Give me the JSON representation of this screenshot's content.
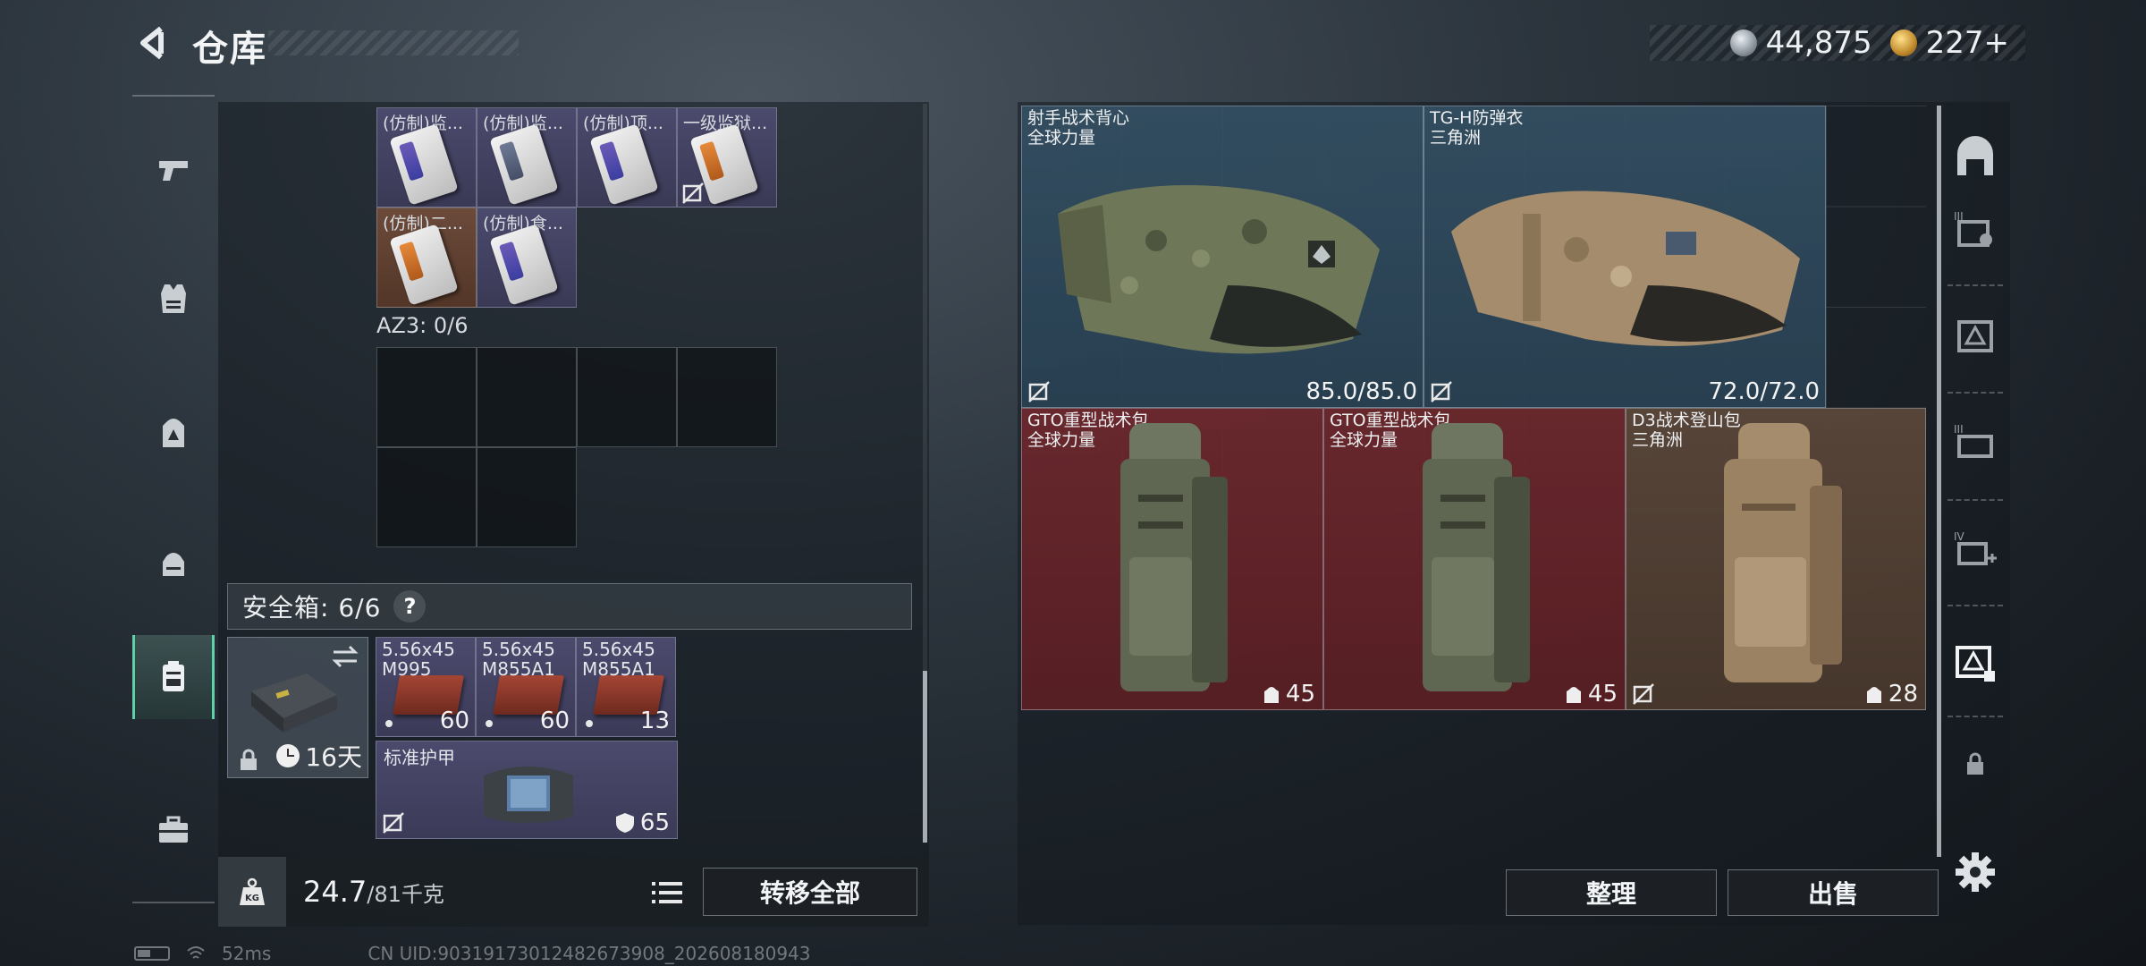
{
  "header": {
    "title": "仓库",
    "currency_silver": "44,875",
    "currency_gold": "227+"
  },
  "left_nav": {
    "items": [
      {
        "icon": "pistol-icon"
      },
      {
        "icon": "vest-icon"
      },
      {
        "icon": "backpack-icon"
      },
      {
        "icon": "bag-icon"
      },
      {
        "icon": "safebox-icon",
        "active": true
      },
      {
        "icon": "briefcase-icon"
      }
    ]
  },
  "container": {
    "items": [
      {
        "label": "(仿制)监..."
      },
      {
        "label": "(仿制)监..."
      },
      {
        "label": "(仿制)顶..."
      },
      {
        "label": "一级监狱..."
      },
      {
        "label": "(仿制)二..."
      },
      {
        "label": "(仿制)食..."
      }
    ],
    "az3_label": "AZ3: 0/6"
  },
  "safebox": {
    "title": "安全箱: 6/6",
    "help": "?",
    "timer": "16天",
    "ammo": [
      {
        "line1": "5.56x45",
        "line2": "M995",
        "count": "60"
      },
      {
        "line1": "5.56x45",
        "line2": "M855A1",
        "count": "60"
      },
      {
        "line1": "5.56x45",
        "line2": "M855A1",
        "count": "13"
      }
    ],
    "armor": {
      "name": "标准护甲",
      "value": "65"
    }
  },
  "weight": {
    "current": "24.7",
    "max": "/81千克"
  },
  "buttons": {
    "transfer_all": "转移全部",
    "sort": "整理",
    "sell": "出售"
  },
  "storage": {
    "items": [
      {
        "name": "射手战术背心",
        "sub": "全球力量",
        "value": "85.0/85.0",
        "rarity": "blue"
      },
      {
        "name": "TG-H防弹衣",
        "sub": "三角洲",
        "value": "72.0/72.0",
        "rarity": "blue"
      },
      {
        "name": "GTO重型战术包",
        "sub": "全球力量",
        "value": "45",
        "rarity": "red"
      },
      {
        "name": "GTO重型战术包",
        "sub": "全球力量",
        "value": "45",
        "rarity": "red"
      },
      {
        "name": "D3战术登山包",
        "sub": "三角洲",
        "value": "28",
        "rarity": "tan"
      }
    ]
  },
  "status": {
    "ping": "52ms",
    "uid": "CN UID:90319173012482673908_202608180943"
  },
  "colors": {
    "accent": "#5fd1a8",
    "rarity_blue": "#345064",
    "rarity_red": "#6e282d",
    "rarity_tan": "#5c483a",
    "rarity_purple": "#4b4a6d"
  }
}
